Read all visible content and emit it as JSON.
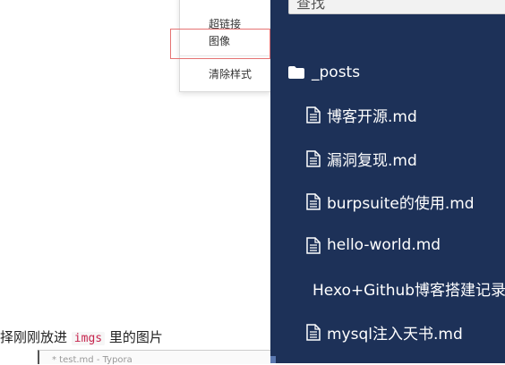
{
  "context_menu": {
    "items": [
      "超链接",
      "图像",
      "清除样式"
    ]
  },
  "document": {
    "paragraph_before": "择刚刚放进",
    "paragraph_code": "imgs",
    "paragraph_after": "里的图片",
    "taskbar_title": "* test.md - Typora"
  },
  "file_panel": {
    "search_placeholder": "查找",
    "folder": "_posts",
    "files": [
      "博客开源.md",
      "漏洞复现.md",
      "burpsuite的使用.md",
      "hello-world.md",
      "Hexo+Github博客搭建记录.md",
      "mysql注入天书.md"
    ]
  },
  "colors": {
    "panel_bg": "#1d3158",
    "highlight_border": "#e57373"
  }
}
